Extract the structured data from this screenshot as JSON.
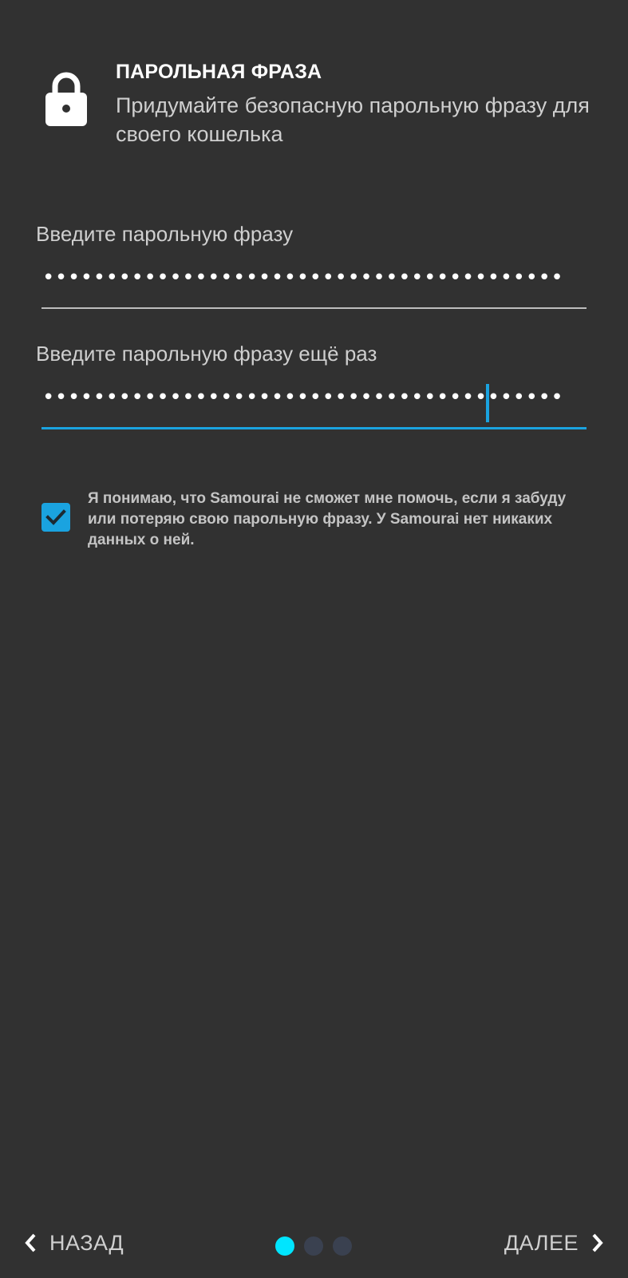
{
  "header": {
    "title": "ПАРОЛЬНАЯ ФРАЗА",
    "subtitle": "Придумайте безопасную парольную фразу для своего кошелька",
    "icon": "lock-icon"
  },
  "form": {
    "passphrase_label": "Введите парольную фразу",
    "passphrase_value": "•••••••••••••••••••••••••••••••••••••••••",
    "confirm_label": "Введите парольную фразу ещё раз",
    "confirm_value": "•••••••••••••••••••••••••••••••••••••••••"
  },
  "consent": {
    "checked": true,
    "text": "Я понимаю, что Samourai не сможет мне помочь, если я забуду или потеряю свою парольную фразу. У Samourai нет никаких данных о ней."
  },
  "footer": {
    "back_label": "НАЗАД",
    "next_label": "ДАЛЕЕ",
    "pages_total": 3,
    "current_page": 1
  },
  "colors": {
    "background": "#313131",
    "accent": "#1aa3e0",
    "active_dot": "#00e5ff",
    "inactive_dot": "#3a4150"
  }
}
